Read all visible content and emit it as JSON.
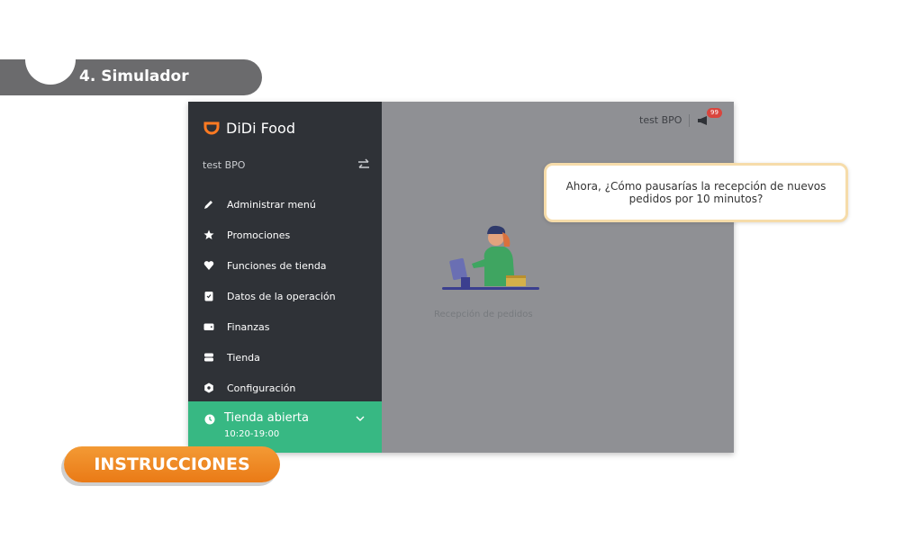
{
  "section": {
    "title": "4. Simulador"
  },
  "app": {
    "brand": "DiDi Food",
    "store_name": "test BPO",
    "menu": [
      {
        "label": "Administrar menú",
        "icon": "pencil-icon"
      },
      {
        "label": "Promociones",
        "icon": "star-icon"
      },
      {
        "label": "Funciones de tienda",
        "icon": "heart-badge-icon"
      },
      {
        "label": "Datos de la operación",
        "icon": "clipboard-icon"
      },
      {
        "label": "Finanzas",
        "icon": "wallet-icon"
      },
      {
        "label": "Tienda",
        "icon": "store-icon"
      },
      {
        "label": "Configuración",
        "icon": "settings-icon"
      }
    ],
    "status": {
      "label": "Tienda abierta",
      "hours": "10:20-19:00"
    },
    "header": {
      "user": "test BPO",
      "notification_count": "99"
    },
    "empty_state": {
      "caption": "Recepción de pedidos"
    }
  },
  "question": "Ahora, ¿Cómo pausarías la recepción de nuevos pedidos por 10 minutos?",
  "instructions_button": "INSTRUCCIONES",
  "colors": {
    "brand_orange": "#ff7a22",
    "sidebar_bg": "#2f3237",
    "status_green": "#37b883",
    "overlay_gray": "#8f9094",
    "badge_red": "#d9453d",
    "button_orange": "#ea7a16",
    "tab_gray": "#6b6b6d"
  }
}
